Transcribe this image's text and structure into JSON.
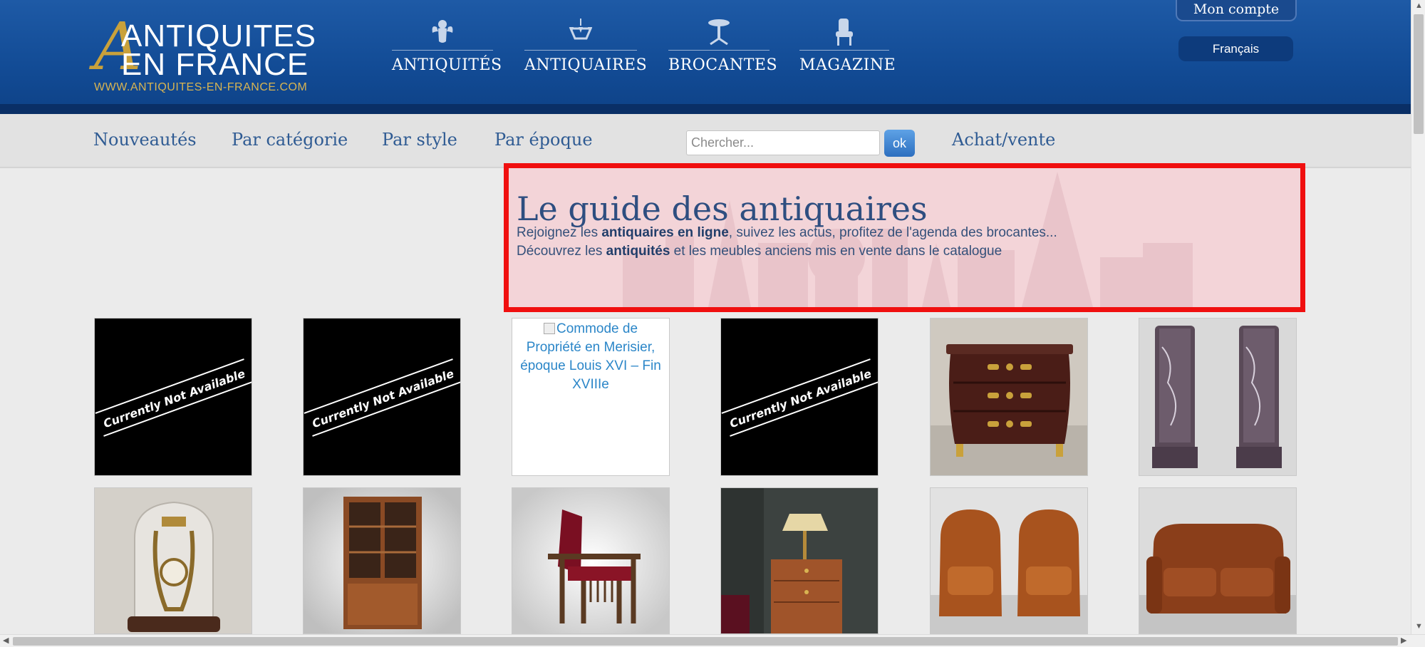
{
  "header": {
    "logo": {
      "line1": "ANTIQUITES",
      "line2": "EN FRANCE",
      "big_letter": "A",
      "url": "WWW.ANTIQUITES-EN-FRANCE.COM"
    },
    "nav": [
      {
        "label": "ANTIQUITÉS",
        "icon": "cherub-icon"
      },
      {
        "label": "ANTIQUAIRES",
        "icon": "chandelier-icon"
      },
      {
        "label": "BROCANTES",
        "icon": "gueridon-table-icon"
      },
      {
        "label": "MAGAZINE",
        "icon": "armchair-icon"
      }
    ],
    "account_label": "Mon compte",
    "language_label": "Français"
  },
  "subnav": {
    "links": [
      "Nouveautés",
      "Par catégorie",
      "Par style",
      "Par époque"
    ],
    "search_placeholder": "Chercher...",
    "search_button": "ok",
    "buy_sell": "Achat/vente"
  },
  "banner": {
    "title": "Le guide des antiquaires",
    "line1_a": "Rejoignez les ",
    "line1_b": "antiquaires en ligne",
    "line1_c": ", suivez les actus, profitez de l'agenda des brocantes...",
    "line2_a": "Découvrez les ",
    "line2_b": "antiquités",
    "line2_c": " et les meubles anciens mis en vente dans le catalogue"
  },
  "products": {
    "row1": [
      {
        "kind": "unavailable",
        "label": "Currently Not Available"
      },
      {
        "kind": "unavailable",
        "label": "Currently Not Available"
      },
      {
        "kind": "alt",
        "label": "Commode de Propriété en Merisier, époque Louis XVI – Fin XVIIIe"
      },
      {
        "kind": "unavailable",
        "label": "Currently Not Available"
      },
      {
        "kind": "photo",
        "icon": "commode-photo"
      },
      {
        "kind": "photo",
        "icon": "marble-columns-photo"
      }
    ],
    "row2": [
      {
        "kind": "photo",
        "icon": "lyre-clock-photo"
      },
      {
        "kind": "photo",
        "icon": "cabinet-photo"
      },
      {
        "kind": "photo",
        "icon": "reclining-chair-photo"
      },
      {
        "kind": "photo",
        "icon": "bedside-table-photo"
      },
      {
        "kind": "photo",
        "icon": "leather-armchairs-photo"
      },
      {
        "kind": "photo",
        "icon": "leather-sofa-photo"
      }
    ]
  },
  "colors": {
    "header_blue": "#124b95",
    "gold": "#c9a13b",
    "link_blue": "#2f5b93",
    "highlight_red": "#f00f0f"
  }
}
